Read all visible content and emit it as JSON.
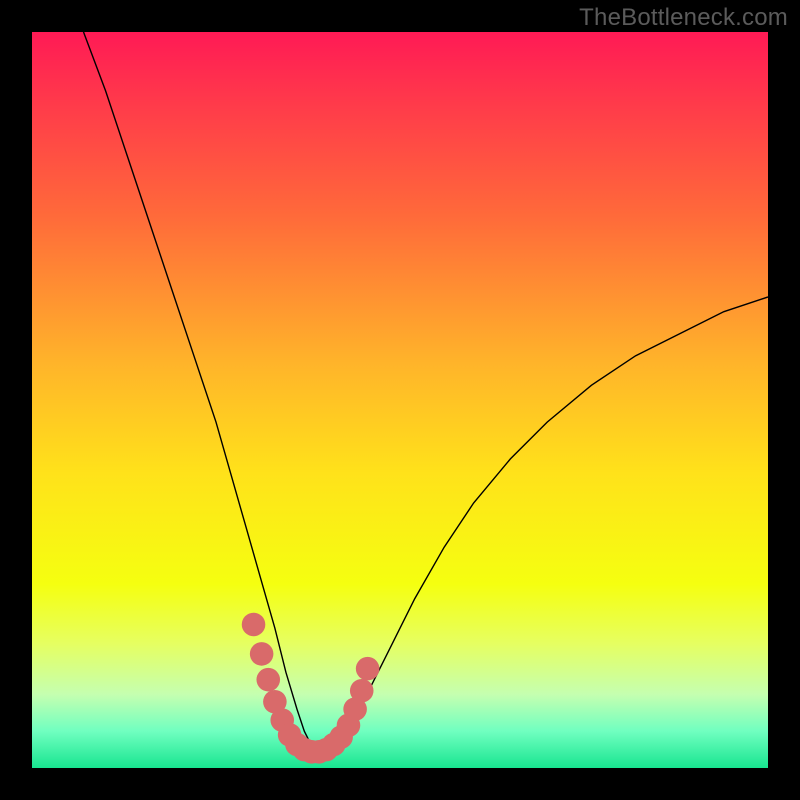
{
  "watermark": "TheBottleneck.com",
  "chart_data": {
    "type": "line",
    "title": "",
    "xlabel": "",
    "ylabel": "",
    "xlim": [
      0,
      100
    ],
    "ylim": [
      0,
      100
    ],
    "grid": false,
    "background_gradient_stops": [
      {
        "offset": 0,
        "color": "#ff1a55"
      },
      {
        "offset": 10,
        "color": "#ff3b4a"
      },
      {
        "offset": 25,
        "color": "#ff6a3a"
      },
      {
        "offset": 45,
        "color": "#ffb42a"
      },
      {
        "offset": 60,
        "color": "#ffe21a"
      },
      {
        "offset": 75,
        "color": "#f5ff10"
      },
      {
        "offset": 83,
        "color": "#e6ff60"
      },
      {
        "offset": 90,
        "color": "#c5ffb0"
      },
      {
        "offset": 95,
        "color": "#70ffc0"
      },
      {
        "offset": 100,
        "color": "#18e590"
      }
    ],
    "series": [
      {
        "name": "bottleneck-curve",
        "color": "#000000",
        "width": 1.4,
        "x": [
          7,
          10,
          13,
          16,
          19,
          22,
          25,
          27,
          29,
          31,
          33,
          34.5,
          36,
          37,
          38,
          39,
          40,
          42,
          44,
          46,
          49,
          52,
          56,
          60,
          65,
          70,
          76,
          82,
          88,
          94,
          100
        ],
        "y": [
          100,
          92,
          83,
          74,
          65,
          56,
          47,
          40,
          33,
          26,
          19,
          13,
          8,
          5,
          3,
          2,
          2.5,
          4,
          7,
          11,
          17,
          23,
          30,
          36,
          42,
          47,
          52,
          56,
          59,
          62,
          64
        ]
      }
    ],
    "marker_overlay": {
      "color": "#d96a6a",
      "radius": 1.6,
      "points_x": [
        30.1,
        31.2,
        32.1,
        33.0,
        34.0,
        35.0,
        36.0,
        37.0,
        38.0,
        39.0,
        40.0,
        41.0,
        42.0,
        43.0,
        43.9,
        44.8,
        45.6
      ],
      "points_y": [
        19.5,
        15.5,
        12.0,
        9.0,
        6.5,
        4.5,
        3.2,
        2.5,
        2.2,
        2.2,
        2.5,
        3.2,
        4.2,
        5.8,
        8.0,
        10.5,
        13.5
      ]
    }
  }
}
